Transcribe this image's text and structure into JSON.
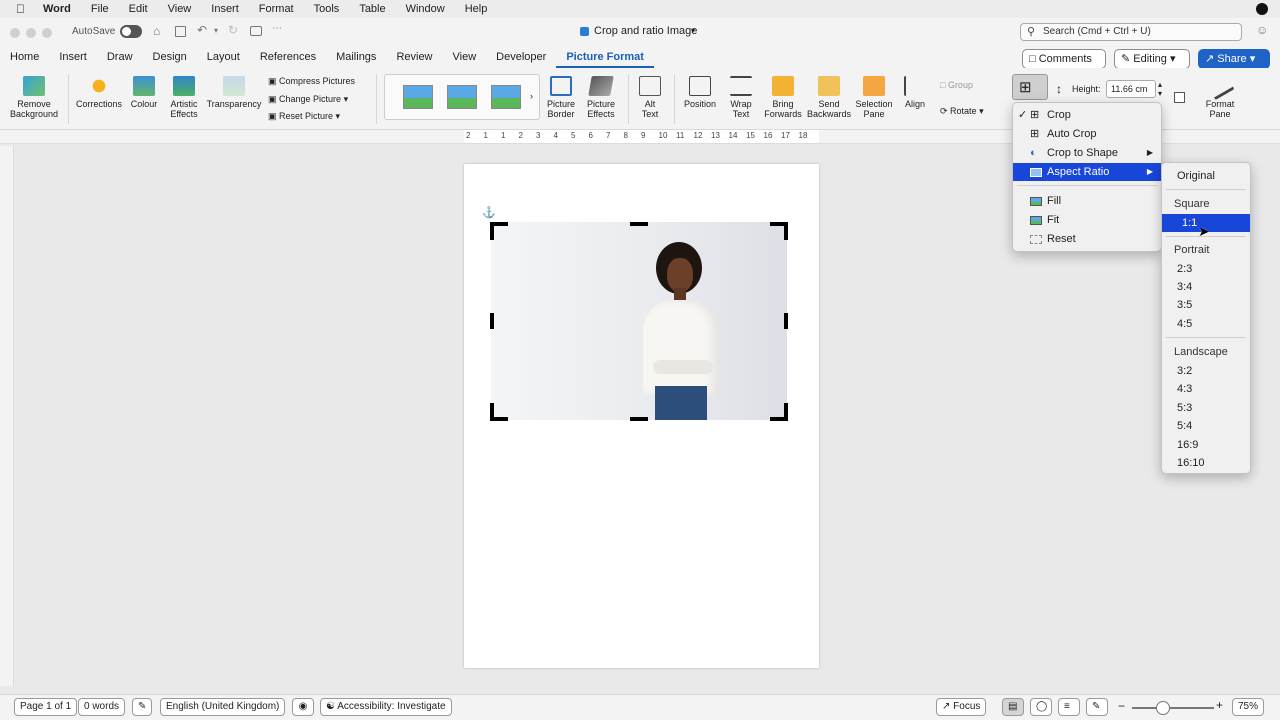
{
  "menubar": {
    "app": "Word",
    "items": [
      "File",
      "Edit",
      "View",
      "Insert",
      "Format",
      "Tools",
      "Table",
      "Window",
      "Help"
    ]
  },
  "titlebar": {
    "autosave": "AutoSave",
    "doc_title": "Crop and ratio Image",
    "search_placeholder": "Search (Cmd + Ctrl + U)"
  },
  "tabs": [
    "Home",
    "Insert",
    "Draw",
    "Design",
    "Layout",
    "References",
    "Mailings",
    "Review",
    "View",
    "Developer",
    "Picture Format"
  ],
  "active_tab": "Picture Format",
  "top_buttons": {
    "comments": "Comments",
    "editing": "Editing",
    "share": "Share"
  },
  "ribbon": {
    "remove_bg": "Remove\nBackground",
    "corrections": "Corrections",
    "colour": "Colour",
    "artistic": "Artistic\nEffects",
    "transparency": "Transparency",
    "compress": "Compress Pictures",
    "change_picture": "Change Picture",
    "reset_picture": "Reset Picture",
    "picture_border": "Picture\nBorder",
    "picture_effects": "Picture\nEffects",
    "alt_text": "Alt\nText",
    "position": "Position",
    "wrap_text": "Wrap\nText",
    "bring_forwards": "Bring\nForwards",
    "send_backwards": "Send\nBackwards",
    "selection_pane": "Selection\nPane",
    "align": "Align",
    "group": "Group",
    "rotate": "Rotate",
    "height_label": "Height:",
    "height_value": "11.66 cm",
    "format_pane": "Format\nPane"
  },
  "crop_menu": {
    "items": [
      {
        "label": "Crop",
        "checked": true
      },
      {
        "label": "Auto Crop"
      },
      {
        "label": "Crop to Shape",
        "submenu": true
      },
      {
        "label": "Aspect Ratio",
        "submenu": true,
        "selected": true
      },
      {
        "label": "Fill"
      },
      {
        "label": "Fit"
      },
      {
        "label": "Reset"
      }
    ]
  },
  "aspect_menu": {
    "original": "Original",
    "square_header": "Square",
    "square": [
      "1:1"
    ],
    "portrait_header": "Portrait",
    "portrait": [
      "2:3",
      "3:4",
      "3:5",
      "4:5"
    ],
    "landscape_header": "Landscape",
    "landscape": [
      "3:2",
      "4:3",
      "5:3",
      "5:4",
      "16:9",
      "16:10"
    ],
    "selected": "1:1"
  },
  "ruler_ticks": [
    "2",
    "1",
    "1",
    "2",
    "3",
    "4",
    "5",
    "6",
    "7",
    "8",
    "9",
    "10",
    "11",
    "12",
    "13",
    "14",
    "15",
    "16",
    "17",
    "18"
  ],
  "statusbar": {
    "page": "Page 1 of 1",
    "words": "0 words",
    "language": "English (United Kingdom)",
    "accessibility": "Accessibility: Investigate",
    "focus": "Focus",
    "zoom": "75%"
  },
  "colors": {
    "accent": "#1b5fb7",
    "menu_highlight": "#1746d8",
    "share": "#1f63c6"
  }
}
